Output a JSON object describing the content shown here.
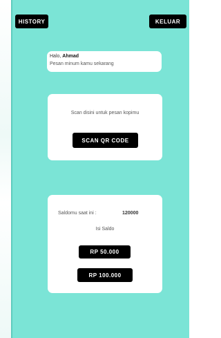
{
  "header": {
    "history_label": "HISTORY",
    "keluar_label": "KELUAR"
  },
  "greeting": {
    "hello_prefix": "Halo, ",
    "user_name": "Ahmad",
    "prompt": "Pesan minum kamu sekarang"
  },
  "scan_card": {
    "instruction": "Scan disini untuk pesan kopimu",
    "button_label": "SCAN QR CODE"
  },
  "saldo_card": {
    "label": "Saldomu saat ini :",
    "value": "120000",
    "topup_label": "Isi Saldo",
    "options": [
      "RP 50.000",
      "RP 100.000"
    ]
  },
  "colors": {
    "background": "#7be4d6",
    "card": "#ffffff",
    "button": "#000000",
    "button_text": "#ffffff"
  }
}
